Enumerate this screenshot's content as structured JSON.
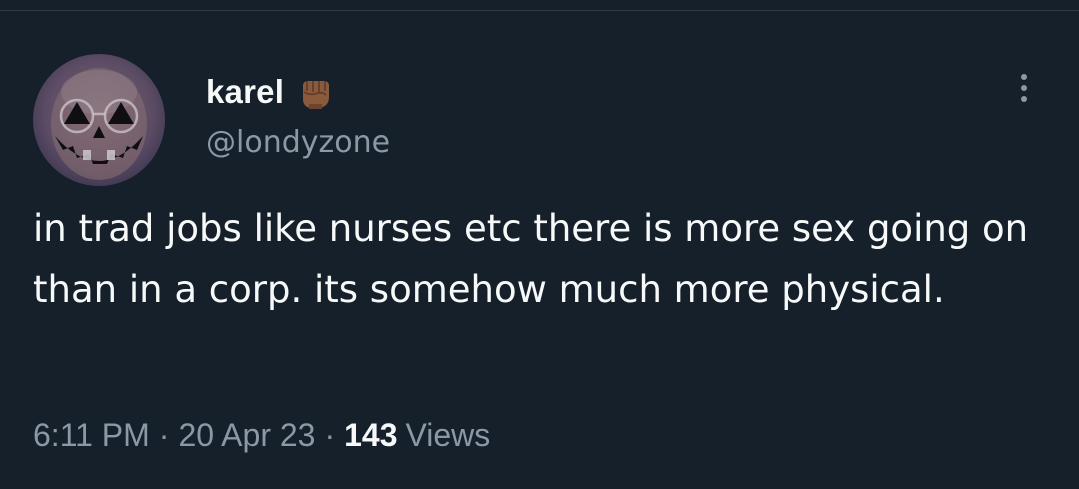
{
  "author": {
    "display_name": "karel",
    "handle": "@londyzone",
    "badge_icon": "raised-fist-icon",
    "avatar_icon": "jack-o-lantern-face-avatar"
  },
  "tweet": {
    "text": "in trad jobs like nurses etc there is more sex going on than in a corp. its somehow much more physical."
  },
  "meta": {
    "time": "6:11 PM",
    "date": "20 Apr 23",
    "separator": "·",
    "views_count": "143",
    "views_label": "Views"
  },
  "menu": {
    "icon": "more-options-icon"
  },
  "colors": {
    "background": "#15202b",
    "primary_text": "#f7f9f9",
    "secondary_text": "#8b98a5"
  }
}
